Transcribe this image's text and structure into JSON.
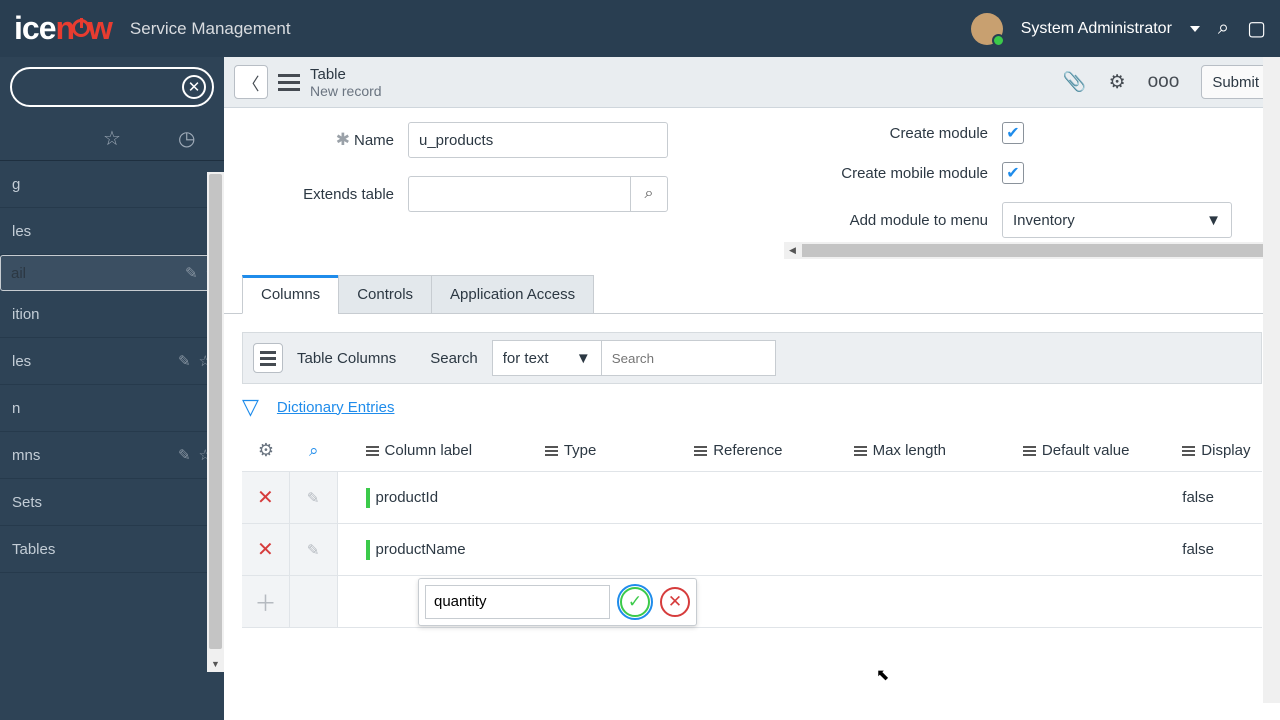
{
  "brand": "Service Management",
  "user": "System Administrator",
  "sidebar": {
    "items": [
      "g",
      "les",
      "ail",
      "ition",
      "les",
      "n",
      "mns",
      "Sets",
      "Tables"
    ]
  },
  "header": {
    "type": "Table",
    "sub": "New record",
    "submit": "Submit"
  },
  "form": {
    "name_label": "Name",
    "name_value": "u_products",
    "extends_label": "Extends table",
    "cm_label": "Create module",
    "cmm_label": "Create mobile module",
    "menu_label": "Add module to menu",
    "menu_value": "Inventory"
  },
  "tabs": [
    "Columns",
    "Controls",
    "Application Access"
  ],
  "tbar": {
    "title": "Table Columns",
    "search": "Search",
    "mode": "for text",
    "ph": "Search"
  },
  "dict": "Dictionary Entries",
  "cols": {
    "label": "Column label",
    "type": "Type",
    "ref": "Reference",
    "max": "Max length",
    "def": "Default value",
    "dis": "Display"
  },
  "rows": [
    {
      "label": "productId",
      "display": "false"
    },
    {
      "label": "productName",
      "display": "false"
    }
  ],
  "newval": "quantity"
}
